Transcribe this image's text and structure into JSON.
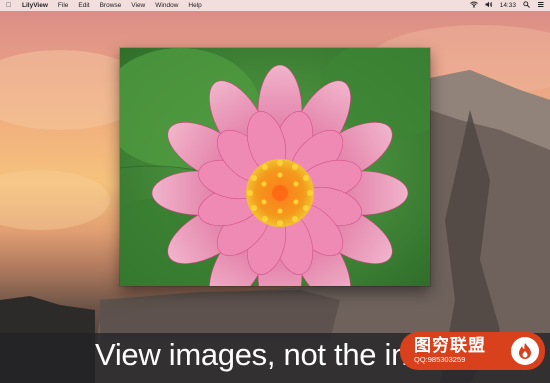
{
  "menubar": {
    "apple_icon": "apple-icon",
    "app_name": "LilyView",
    "items": [
      "File",
      "Edit",
      "Browse",
      "View",
      "Window",
      "Help"
    ],
    "status_icons": [
      "wifi-icon",
      "volume-icon",
      "search-icon",
      "list-icon"
    ],
    "clock": "14:33"
  },
  "photo": {
    "subject": "pink-water-lily-image"
  },
  "caption": {
    "text": "View images, not the intern"
  },
  "watermark": {
    "title": "图穷联盟",
    "subtitle": "QQ:985303259",
    "color": "#d9401c"
  },
  "colors": {
    "menubar_bg": "#f5ecec",
    "accent": "#d9401c"
  }
}
